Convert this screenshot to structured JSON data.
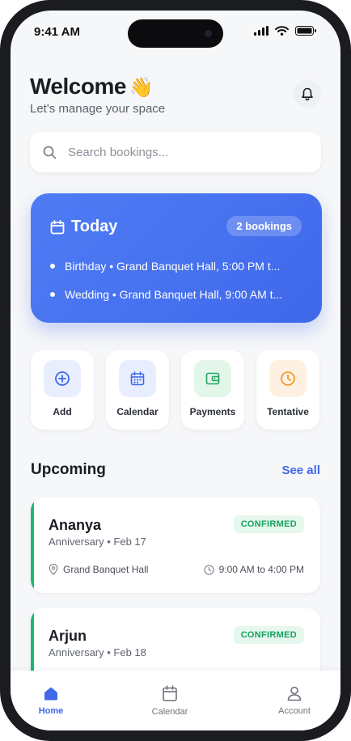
{
  "status_bar": {
    "time": "9:41 AM"
  },
  "header": {
    "title": "Welcome",
    "emoji": "👋",
    "subtitle": "Let's manage your space"
  },
  "search": {
    "placeholder": "Search bookings..."
  },
  "today": {
    "title": "Today",
    "badge": "2 bookings",
    "items": [
      "Birthday • Grand Banquet Hall, 5:00 PM t...",
      "Wedding • Grand Banquet Hall, 9:00 AM t..."
    ]
  },
  "quick_actions": [
    {
      "label": "Add",
      "icon": "plus-circle-icon",
      "bg": "#e8eefe",
      "color": "#3f68ea"
    },
    {
      "label": "Calendar",
      "icon": "calendar-icon",
      "bg": "#e8eefe",
      "color": "#3f68ea"
    },
    {
      "label": "Payments",
      "icon": "wallet-icon",
      "bg": "#e3f6ea",
      "color": "#22a566"
    },
    {
      "label": "Tentative",
      "icon": "clock-icon",
      "bg": "#fef1e2",
      "color": "#f39a2b"
    }
  ],
  "upcoming": {
    "title": "Upcoming",
    "see_all": "See all",
    "bookings": [
      {
        "name": "Ananya",
        "meta": "Anniversary • Feb 17",
        "status": "CONFIRMED",
        "venue": "Grand Banquet Hall",
        "time": "9:00 AM to 4:00 PM"
      },
      {
        "name": "Arjun",
        "meta": "Anniversary • Feb 18",
        "status": "CONFIRMED",
        "venue": "",
        "time": ""
      }
    ]
  },
  "tabs": [
    {
      "label": "Home",
      "icon": "home-icon",
      "active": true
    },
    {
      "label": "Calendar",
      "icon": "calendar-icon",
      "active": false
    },
    {
      "label": "Account",
      "icon": "user-icon",
      "active": false
    }
  ],
  "colors": {
    "accent": "#3f68ea",
    "confirmed": "#16a35f",
    "confirmed_bg": "#e6f7ee"
  }
}
